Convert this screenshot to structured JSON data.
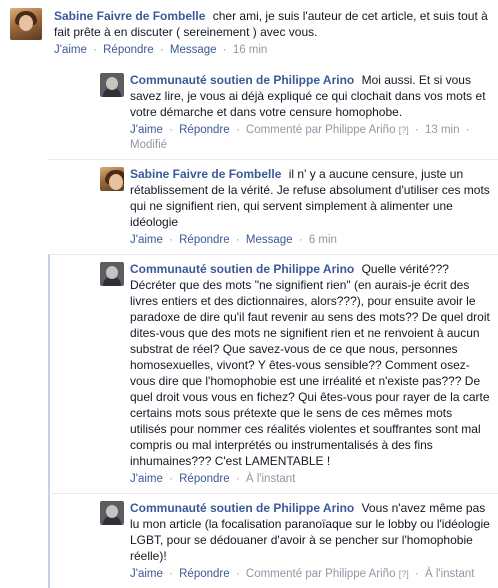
{
  "comments": [
    {
      "author": "Sabine Faivre de Fombelle",
      "avatar": "woman-profile-photo",
      "text": "cher ami, je suis l'auteur de cet article, et suis tout à fait prête à en discuter ( sereinement ) avec vous.",
      "like": "J'aime",
      "reply": "Répondre",
      "message": "Message",
      "time": "16 min"
    }
  ],
  "replies": [
    {
      "author": "Communauté soutien de Philippe Arino",
      "avatar": "man-profile-photo",
      "text": "Moi aussi. Et si vous savez lire, je vous ai déjà expliqué ce qui clochait dans vos mots et votre démarche et dans votre censure homophobe.",
      "like": "J'aime",
      "reply": "Répondre",
      "commented_by": "Commenté par Philippe Ariño",
      "bracket": "[?]",
      "time": "13 min",
      "modified": "Modifié"
    },
    {
      "author": "Sabine Faivre de Fombelle",
      "avatar": "woman-profile-photo",
      "text": "il n' y a aucune censure, juste un rétablissement de la vérité. Je refuse absolument d'utiliser ces mots qui ne signifient rien, qui servent simplement à alimenter une idéologie",
      "like": "J'aime",
      "reply": "Répondre",
      "message": "Message",
      "time": "6 min"
    },
    {
      "author": "Communauté soutien de Philippe Arino",
      "avatar": "man-profile-photo",
      "text": "Quelle vérité??? Décréter que des mots \"ne signifient rien\" (en aurais-je écrit des livres entiers et des dictionnaires, alors???), pour ensuite avoir le paradoxe de dire qu'il faut revenir au sens des mots?? De quel droit dites-vous que des mots ne signifient rien et ne renvoient à aucun substrat de réel? Que savez-vous de ce que nous, personnes homosexuelles, vivont? Y êtes-vous sensible?? Comment osez-vous dire que l'homophobie est une irréalité et n'existe pas??? De quel droit vous vous en fichez? Qui êtes-vous pour rayer de la carte certains mots sous prétexte que le sens de ces mêmes mots utilisés pour nommer ces réalités violentes et souffrantes sont mal compris ou mal interprétés ou instrumentalisés à des fins inhumaines??? C'est LAMENTABLE !",
      "like": "J'aime",
      "reply": "Répondre",
      "time": "À l'instant"
    },
    {
      "author": "Communauté soutien de Philippe Arino",
      "avatar": "man-profile-photo",
      "text": "Vous n'avez même pas lu mon article (la focalisation paranoïaque sur le lobby ou l'idéologie LGBT, pour se dédouaner d'avoir à se pencher sur l'homophobie réelle)!",
      "like": "J'aime",
      "reply": "Répondre",
      "commented_by": "Commenté par Philippe Ariño",
      "bracket": "[?]",
      "time": "À l'instant"
    }
  ],
  "colors": {
    "link": "#3b5998",
    "meta": "#9197a3",
    "text": "#141823",
    "highlight_border": "#c5d0e6"
  }
}
